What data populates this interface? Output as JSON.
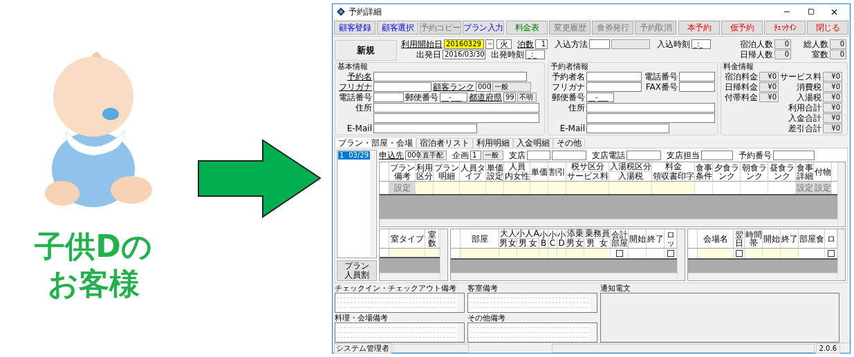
{
  "caption": {
    "lines": [
      "子供Dの",
      "お客様"
    ]
  },
  "window": {
    "title": "予約詳細"
  },
  "toolbar_left": [
    {
      "label": "顧客登録",
      "kind": "blue",
      "disabled": false
    },
    {
      "label": "顧客選択",
      "kind": "blue",
      "disabled": false
    },
    {
      "label": "予約コピー",
      "kind": "plain",
      "disabled": true
    },
    {
      "label": "プラン入力",
      "kind": "blue",
      "disabled": false
    }
  ],
  "toolbar_middle": [
    {
      "label": "料金表",
      "kind": "green",
      "disabled": false
    },
    {
      "label": "変更履歴",
      "kind": "plain",
      "disabled": true
    },
    {
      "label": "食券発行",
      "kind": "plain",
      "disabled": true
    },
    {
      "label": "予約取消",
      "kind": "plain",
      "disabled": true
    }
  ],
  "toolbar_right": [
    {
      "label": "本予約",
      "kind": "red",
      "disabled": false
    },
    {
      "label": "仮予約",
      "kind": "red",
      "disabled": false
    },
    {
      "label": "ﾁｪｯｸｲﾝ",
      "kind": "red",
      "disabled": false
    },
    {
      "label": "閉じる",
      "kind": "red",
      "disabled": false
    }
  ],
  "header": {
    "status": "新規",
    "start_date": {
      "label": "利用開始日",
      "value": "20160329",
      "link": true
    },
    "weekday": "火",
    "nights": {
      "label": "泊数",
      "value": "1",
      "link": true
    },
    "arrival_method": {
      "label": "入込方法",
      "link": false
    },
    "arrival_time": {
      "label": "入込時刻",
      "value": "_:_",
      "link": false
    },
    "departure_date": {
      "label": "出発日",
      "value": "2016/03/30",
      "link": false
    },
    "departure_time": {
      "label": "出発時刻",
      "value": "_:_",
      "link": false
    },
    "counts": [
      {
        "label": "宿泊人数",
        "value": "0"
      },
      {
        "label": "総人数",
        "value": "0"
      },
      {
        "label": "日帰人数",
        "value": "0"
      },
      {
        "label": "室数",
        "value": "0"
      }
    ]
  },
  "basic_info": {
    "title": "基本情報",
    "name": {
      "label": "予約名",
      "link": true
    },
    "kana": {
      "label": "フリガナ",
      "link": true
    },
    "rank": {
      "label": "顧客ランク",
      "code": "000",
      "value": "一般",
      "link": true
    },
    "phone": {
      "label": "電話番号",
      "link": false
    },
    "postal": {
      "label": "郵便番号",
      "value": "__-___",
      "link": false
    },
    "prefecture": {
      "label": "都道府県",
      "code": "99",
      "value": "不明",
      "link": true
    },
    "address": {
      "label": "住所",
      "link": false
    },
    "email": {
      "label": "E-Mail",
      "link": false
    }
  },
  "booker_info": {
    "title": "予約者情報",
    "name": {
      "label": "予約者名"
    },
    "phone": {
      "label": "電話番号"
    },
    "kana": {
      "label": "フリガナ"
    },
    "fax": {
      "label": "FAX番号"
    },
    "postal": {
      "label": "郵便番号",
      "value": "__-___"
    },
    "address": {
      "label": "住所"
    },
    "email": {
      "label": "E-Mail"
    }
  },
  "charges": {
    "title": "料金情報",
    "left": [
      {
        "label": "宿泊料金",
        "value": "¥0"
      },
      {
        "label": "日帰料金",
        "value": "¥0"
      },
      {
        "label": "付帯料金",
        "value": "¥0"
      }
    ],
    "right": [
      {
        "label": "サービス料",
        "value": "¥0"
      },
      {
        "label": "消費税",
        "value": "¥0"
      },
      {
        "label": "入湯税",
        "value": "¥0"
      },
      {
        "label": "利用合計",
        "value": "¥0"
      },
      {
        "label": "入金合計",
        "value": "¥0"
      },
      {
        "label": "差引合計",
        "value": "¥0"
      }
    ]
  },
  "tabs": [
    {
      "label": "プラン・部屋・会場",
      "selected": true
    },
    {
      "label": "宿泊者リスト",
      "selected": false
    },
    {
      "label": "利用明細",
      "selected": false
    },
    {
      "label": "入金明細",
      "selected": false
    },
    {
      "label": "その他",
      "selected": false
    }
  ],
  "plan_list": [
    {
      "number": "1",
      "date": "03/29",
      "selected": true
    }
  ],
  "plan_bar": {
    "client": {
      "label": "申込先",
      "code": "000",
      "value": "直手配"
    },
    "project": {
      "label": "企画",
      "code": "1",
      "value": "一般"
    },
    "branch": {
      "label": "支店"
    },
    "branch_phone": {
      "label": "支店電話"
    },
    "branch_staff": {
      "label": "支店担当"
    },
    "booking_no": {
      "label": "予約番号"
    }
  },
  "plan_grid": {
    "columns": [
      {
        "label": "プラン備考",
        "button": "設定"
      },
      {
        "label": "利用区分"
      },
      {
        "label": "プラン明細"
      },
      {
        "label": "人員タイプ"
      },
      {
        "label": "単価設定"
      },
      {
        "label": "人員",
        "bottom": "内女性"
      },
      {
        "label": "単価"
      },
      {
        "label": "割引"
      },
      {
        "label": "税サ区分",
        "bottom": "サービス料"
      },
      {
        "label": "入湯税区分",
        "bottom": "入湯税"
      },
      {
        "label": "料金",
        "bottom": "領収書印字"
      },
      {
        "label": "食事条件"
      },
      {
        "label": "夕食ランク"
      },
      {
        "label": "朝食ランク"
      },
      {
        "label": "昼食ランク"
      },
      {
        "label": "食事詳細",
        "button": "設定"
      },
      {
        "label": "付物",
        "button": "設定"
      }
    ]
  },
  "split_button": "プラン人員割",
  "room_type_grid": {
    "columns": [
      {
        "label": "室タイプ"
      },
      {
        "label": "室数"
      }
    ]
  },
  "room_grid": {
    "columns": [
      {
        "label": "部屋"
      },
      {
        "label": "大人",
        "sub": [
          "男",
          "女"
        ]
      },
      {
        "label": "小人A",
        "sub": [
          "男",
          "女"
        ]
      },
      {
        "label": "小B"
      },
      {
        "label": "小C"
      },
      {
        "label": "小D"
      },
      {
        "label": "添乗",
        "sub": [
          "男",
          "女"
        ]
      },
      {
        "label": "乗務員",
        "sub": [
          "男",
          "女"
        ]
      },
      {
        "label": "会計部屋",
        "checked": false
      },
      {
        "label": "開始"
      },
      {
        "label": "終了"
      },
      {
        "label": "ロッ",
        "checked": false
      }
    ]
  },
  "venue_grid": {
    "columns": [
      {
        "label": "会場名"
      },
      {
        "label": "翌日",
        "checked": false
      },
      {
        "label": "時間帯"
      },
      {
        "label": "開始"
      },
      {
        "label": "終了"
      },
      {
        "label": "部屋食"
      },
      {
        "label": "ロ",
        "checked": false
      }
    ]
  },
  "memos": [
    {
      "label": "チェックイン・チェックアウト備考"
    },
    {
      "label": "客室備考"
    },
    {
      "label": "料理・会場備考"
    },
    {
      "label": "その他備考"
    }
  ],
  "notice": {
    "label": "通知電文"
  },
  "status_bar": {
    "user": "システム管理者",
    "version": "2.0.6"
  }
}
